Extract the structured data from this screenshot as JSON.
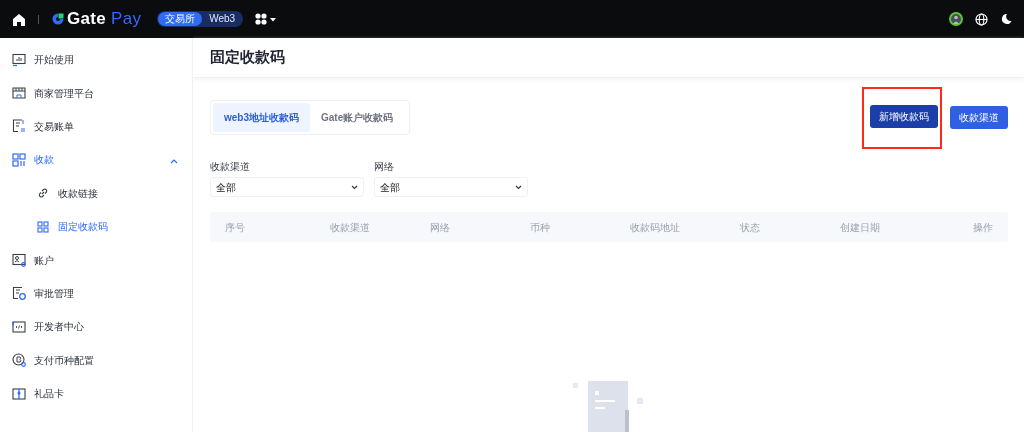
{
  "topbar": {
    "logo": {
      "text": "Gate",
      "accent": "Pay"
    },
    "switch": [
      {
        "label": "交易所",
        "selected": true
      },
      {
        "label": "Web3",
        "selected": false
      }
    ]
  },
  "sidebar": {
    "items": [
      {
        "label": "开始使用",
        "selected": false
      },
      {
        "label": "商家管理平台",
        "selected": false
      },
      {
        "label": "交易账单",
        "selected": false
      },
      {
        "label": "收款",
        "selected": true,
        "expanded": true,
        "children": [
          {
            "label": "收款链接",
            "selected": false
          },
          {
            "label": "固定收款码",
            "selected": true
          }
        ]
      },
      {
        "label": "账户",
        "selected": false
      },
      {
        "label": "审批管理",
        "selected": false
      },
      {
        "label": "开发者中心",
        "selected": false
      },
      {
        "label": "支付币种配置",
        "selected": false
      },
      {
        "label": "礼品卡",
        "selected": false
      }
    ]
  },
  "page": {
    "title": "固定收款码",
    "tabs": [
      {
        "label": "web3地址收款码",
        "selected": true
      },
      {
        "label": "Gate账户收款码",
        "selected": false
      }
    ],
    "buttons": [
      {
        "label": "新增收款码",
        "highlighted": true,
        "kind": "dark"
      },
      {
        "label": "收款渠道",
        "highlighted": false,
        "kind": "primary"
      }
    ],
    "filters": [
      {
        "label": "收款渠道",
        "value": "全部"
      },
      {
        "label": "网络",
        "value": "全部"
      }
    ],
    "table": {
      "columns": [
        "序号",
        "收款渠道",
        "网络",
        "币种",
        "收款码地址",
        "状态",
        "创建日期",
        "操作"
      ]
    }
  }
}
